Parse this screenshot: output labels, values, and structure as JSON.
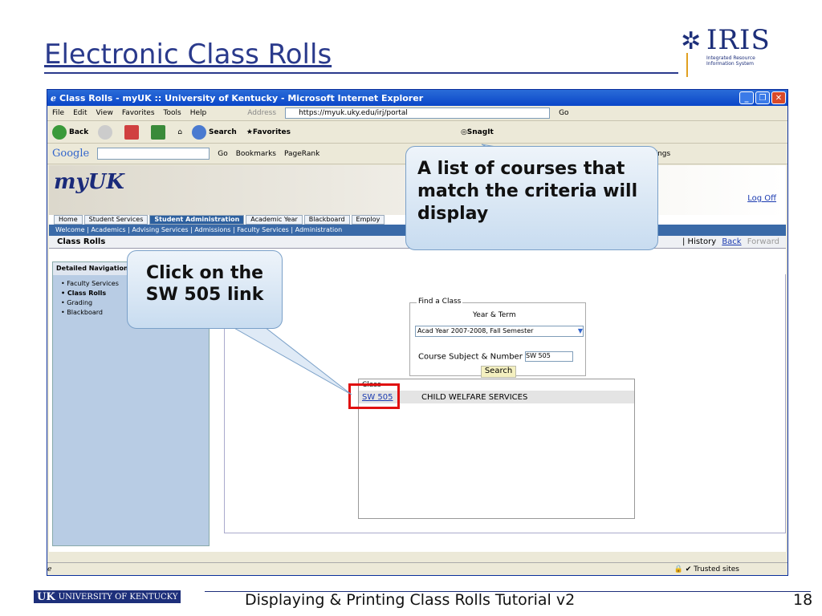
{
  "slide": {
    "title": "Electronic Class Rolls",
    "logo": "IRIS",
    "logo_sub": "Integrated Resource Information System",
    "footer_logo": "UNIVERSITY OF KENTUCKY",
    "footer_uk": "UK",
    "footer_text": "Displaying & Printing Class Rolls Tutorial v2",
    "page_number": "18"
  },
  "browser": {
    "title": "Class Rolls - myUK :: University of Kentucky - Microsoft Internet Explorer",
    "menu": [
      "File",
      "Edit",
      "View",
      "Favorites",
      "Tools",
      "Help"
    ],
    "address_label": "Address",
    "address": "https://myuk.uky.edu/irj/portal",
    "go": "Go",
    "toolbar": [
      "Back",
      "Search",
      "Favorites",
      "SnagIt"
    ],
    "google": "Google",
    "google_items": [
      "Go",
      "Bookmarks",
      "PageRank",
      "Settings"
    ],
    "status_right": "Trusted sites"
  },
  "portal": {
    "brand": "myUK",
    "logoff": "Log Off",
    "tabs": [
      "Home",
      "Student Services",
      "Student Administration",
      "Academic Year",
      "Blackboard",
      "Employ"
    ],
    "subnav": "Welcome | Academics | Advising Services | Admissions | Faculty Services | Administration",
    "page_title": "Class Rolls",
    "history": "| History",
    "back": "Back",
    "forward": "Forward",
    "left_header": "Detailed Navigation",
    "left_items": [
      "Faculty Services",
      "Class Rolls",
      "Grading",
      "Blackboard"
    ],
    "find_legend": "Find a Class",
    "year_term_label": "Year & Term",
    "year_term_value": "Acad Year 2007-2008, Fall Semester",
    "course_label": "Course Subject & Number",
    "course_value": "SW 505",
    "search_btn": "Search",
    "results_header": "Class",
    "results": [
      {
        "code": "SW 505",
        "name": "CHILD WELFARE SERVICES"
      }
    ]
  },
  "callouts": {
    "list": "A list of courses that match the criteria will display",
    "click": "Click on the SW 505 link"
  }
}
